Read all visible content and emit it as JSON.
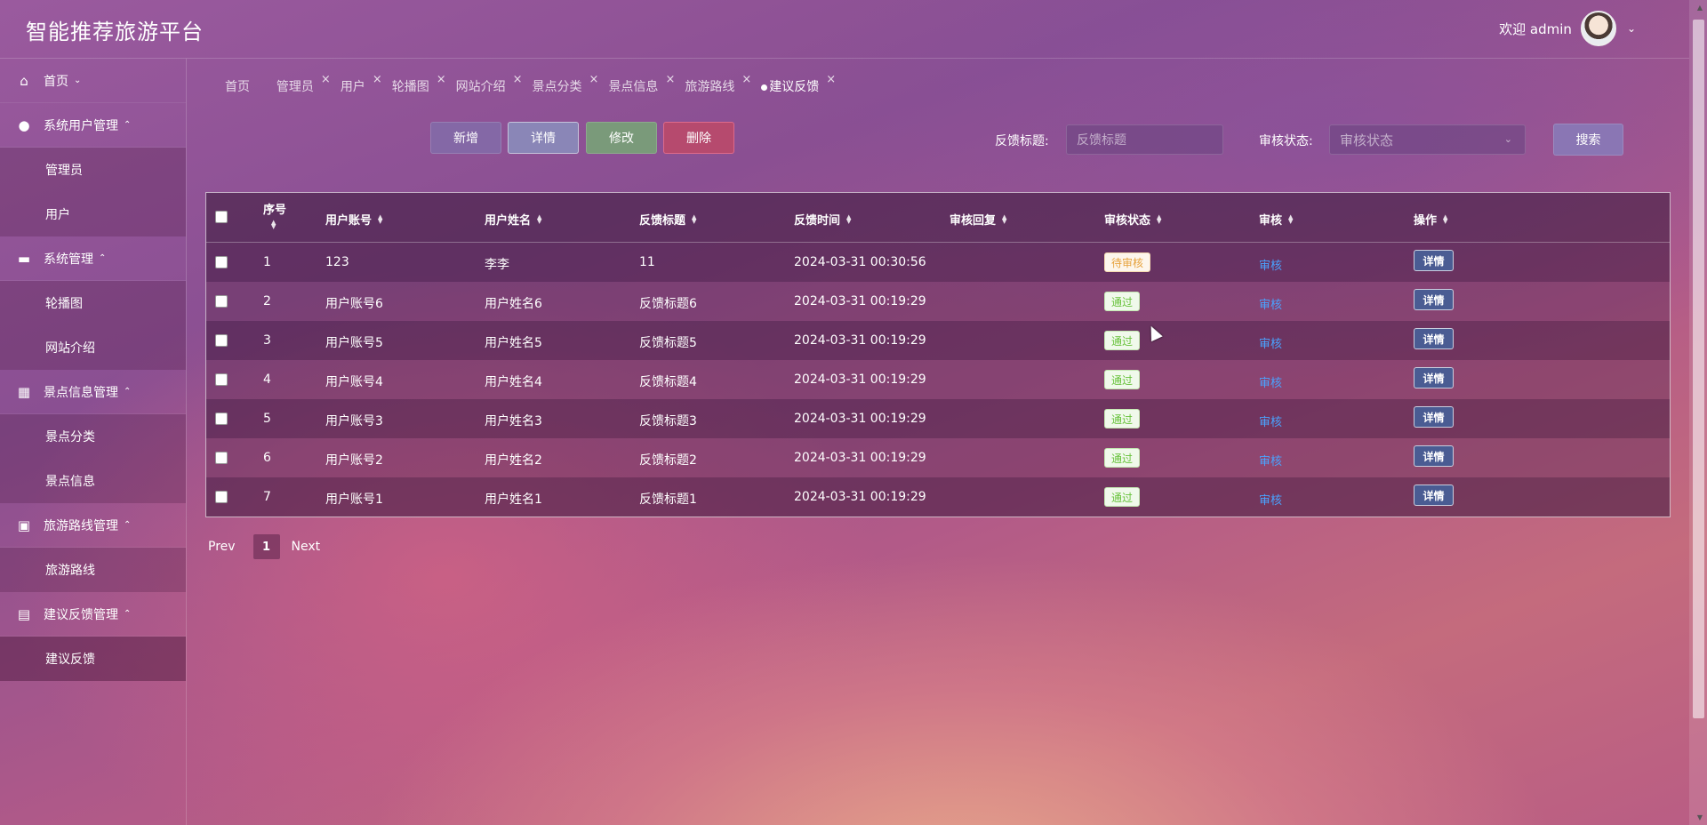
{
  "header": {
    "brand": "智能推荐旅游平台",
    "welcome": "欢迎 admin"
  },
  "sidebar": {
    "home": "首页",
    "groups": [
      {
        "label": "系统用户管理",
        "icon": "user-icon",
        "items": [
          "管理员",
          "用户"
        ]
      },
      {
        "label": "系统管理",
        "icon": "settings-icon",
        "items": [
          "轮播图",
          "网站介绍"
        ]
      },
      {
        "label": "景点信息管理",
        "icon": "grid-icon",
        "items": [
          "景点分类",
          "景点信息"
        ]
      },
      {
        "label": "旅游路线管理",
        "icon": "briefcase-icon",
        "items": [
          "旅游路线"
        ]
      },
      {
        "label": "建议反馈管理",
        "icon": "layout-icon",
        "items": [
          "建议反馈"
        ]
      }
    ]
  },
  "tabs": [
    "首页",
    "管理员",
    "用户",
    "轮播图",
    "网站介绍",
    "景点分类",
    "景点信息",
    "旅游路线",
    "建议反馈"
  ],
  "toolbar": {
    "add": "新增",
    "detail": "详情",
    "edit": "修改",
    "delete": "删除",
    "title_label": "反馈标题:",
    "title_placeholder": "反馈标题",
    "status_label": "审核状态:",
    "status_placeholder": "审核状态",
    "search": "搜索"
  },
  "table": {
    "columns": [
      "序号",
      "用户账号",
      "用户姓名",
      "反馈标题",
      "反馈时间",
      "审核回复",
      "审核状态",
      "审核",
      "操作"
    ],
    "audit_link": "审核",
    "detail_btn": "详情",
    "rows": [
      {
        "no": "1",
        "account": "123",
        "name": "李李",
        "title": "11",
        "time": "2024-03-31 00:30:56",
        "reply": "",
        "status": "待审核",
        "status_type": "pending"
      },
      {
        "no": "2",
        "account": "用户账号6",
        "name": "用户姓名6",
        "title": "反馈标题6",
        "time": "2024-03-31 00:19:29",
        "reply": "",
        "status": "通过",
        "status_type": "pass"
      },
      {
        "no": "3",
        "account": "用户账号5",
        "name": "用户姓名5",
        "title": "反馈标题5",
        "time": "2024-03-31 00:19:29",
        "reply": "",
        "status": "通过",
        "status_type": "pass"
      },
      {
        "no": "4",
        "account": "用户账号4",
        "name": "用户姓名4",
        "title": "反馈标题4",
        "time": "2024-03-31 00:19:29",
        "reply": "",
        "status": "通过",
        "status_type": "pass"
      },
      {
        "no": "5",
        "account": "用户账号3",
        "name": "用户姓名3",
        "title": "反馈标题3",
        "time": "2024-03-31 00:19:29",
        "reply": "",
        "status": "通过",
        "status_type": "pass"
      },
      {
        "no": "6",
        "account": "用户账号2",
        "name": "用户姓名2",
        "title": "反馈标题2",
        "time": "2024-03-31 00:19:29",
        "reply": "",
        "status": "通过",
        "status_type": "pass"
      },
      {
        "no": "7",
        "account": "用户账号1",
        "name": "用户姓名1",
        "title": "反馈标题1",
        "time": "2024-03-31 00:19:29",
        "reply": "",
        "status": "通过",
        "status_type": "pass"
      }
    ]
  },
  "pager": {
    "prev": "Prev",
    "page": "1",
    "next": "Next"
  }
}
